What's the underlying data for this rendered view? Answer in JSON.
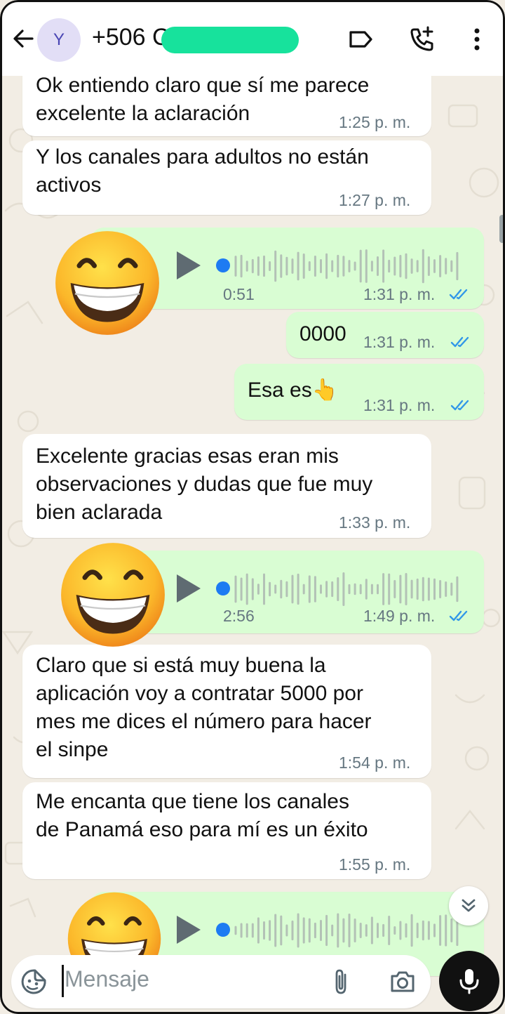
{
  "header": {
    "avatar_letter": "Y",
    "contact": "+506 C"
  },
  "messages": [
    {
      "id": "m1",
      "direction": "in",
      "lines": [
        "Ok entiendo claro que sí me parece",
        "excelente la aclaración"
      ],
      "time": "1:25 p. m."
    },
    {
      "id": "m2",
      "direction": "in",
      "lines": [
        "Y los canales para adultos no están",
        "activos"
      ],
      "time": "1:27 p. m."
    },
    {
      "id": "v1",
      "direction": "out",
      "type": "voice",
      "duration": "0:51",
      "time": "1:31 p. m.",
      "read": true
    },
    {
      "id": "m3",
      "direction": "out",
      "lines": [
        "0000"
      ],
      "time": "1:31 p. m.",
      "read": true
    },
    {
      "id": "m4",
      "direction": "out",
      "lines": [
        "Esa es👆"
      ],
      "time": "1:31 p. m.",
      "read": true
    },
    {
      "id": "m5",
      "direction": "in",
      "lines": [
        "Excelente gracias esas eran mis",
        "observaciones y dudas que fue muy",
        "bien aclarada"
      ],
      "time": "1:33 p. m."
    },
    {
      "id": "v2",
      "direction": "out",
      "type": "voice",
      "duration": "2:56",
      "time": "1:49 p. m.",
      "read": true
    },
    {
      "id": "m6",
      "direction": "in",
      "lines": [
        "Claro que si está muy buena la",
        "aplicación voy a contratar 5000 por",
        "mes me dices el número para hacer",
        "el sinpe"
      ],
      "time": "1:54 p. m."
    },
    {
      "id": "m7",
      "direction": "in",
      "lines": [
        "Me encanta que tiene los canales",
        "de Panamá eso para mí es un éxito"
      ],
      "time": "1:55 p. m."
    },
    {
      "id": "v3",
      "direction": "out",
      "type": "voice",
      "duration": "",
      "time": "",
      "read": true
    }
  ],
  "composer": {
    "placeholder": "Mensaje"
  },
  "icons": {
    "back": "arrow-left-icon",
    "label": "label-tag-icon",
    "call": "add-call-icon",
    "menu": "more-vert-icon",
    "sticker": "sticker-icon",
    "attach": "paperclip-icon",
    "camera": "camera-icon",
    "mic": "microphone-icon",
    "scroll": "chevron-double-down-icon",
    "emoji": "grinning-face-emoji"
  },
  "colors": {
    "incoming": "#ffffff",
    "outgoing": "#d9fdd3",
    "wallpaper": "#f2ede4",
    "read_ticks": "#3197e8",
    "redaction": "#17e29c"
  }
}
